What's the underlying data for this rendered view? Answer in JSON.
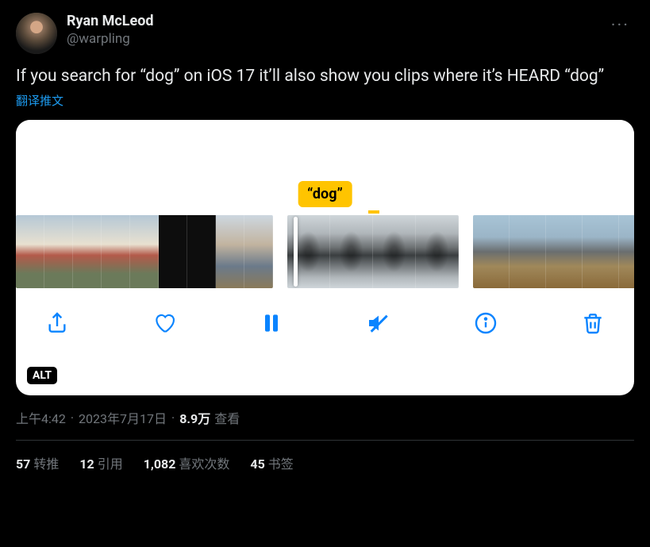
{
  "author": {
    "display_name": "Ryan McLeod",
    "handle": "@warpling"
  },
  "tweet": {
    "body": "If you search for “dog” on iOS 17 it’ll also show you clips where it’s HEARD “dog”",
    "translate_label": "翻译推文"
  },
  "media": {
    "caption_tag": "“dog”",
    "alt_badge": "ALT",
    "toolbar": {
      "share": "share",
      "like": "like",
      "pause": "pause",
      "mute": "mute",
      "info": "info",
      "trash": "trash"
    }
  },
  "meta": {
    "time": "上午4:42",
    "date": "2023年7月17日",
    "views_count": "8.9万",
    "views_label": "查看"
  },
  "stats": {
    "retweets": {
      "count": "57",
      "label": "转推"
    },
    "quotes": {
      "count": "12",
      "label": "引用"
    },
    "likes": {
      "count": "1,082",
      "label": "喜欢次数"
    },
    "bookmarks": {
      "count": "45",
      "label": "书签"
    }
  }
}
